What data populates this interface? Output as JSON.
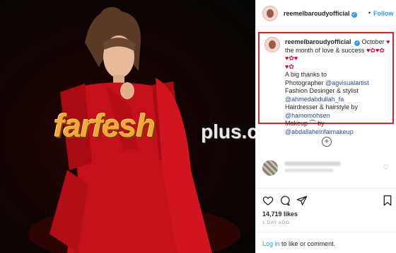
{
  "header": {
    "username": "reemelbaroudyofficial",
    "separator": "•",
    "follow_label": "Follow"
  },
  "caption": {
    "username": "reemelbaroudyofficial",
    "line1": "October",
    "line2": "the month of love & success",
    "thanks": "A big thanks to",
    "photographer_label": "Photographer",
    "photographer_handle": "@agvisualartist",
    "fashion_label": "Fashion Desinger & stylist",
    "fashion_handle": "@ahmedabdullah_fa",
    "hair_label": "Hairdresser & hairstyle by",
    "hair_handle": "@hamomohsen",
    "makeup_label": "Makeup",
    "makeup_by": "by",
    "makeup_handle": "@abdallahelrifaimakeup"
  },
  "watermark": {
    "main": "farfesh",
    "sub": "plus.com"
  },
  "post": {
    "likes": "14,719 likes",
    "date": "1 DAY AGO"
  },
  "footer": {
    "login_link": "Log in",
    "login_text": "to like or comment."
  },
  "colors": {
    "accent": "#3897f0",
    "highlight_border": "#e0242b"
  }
}
